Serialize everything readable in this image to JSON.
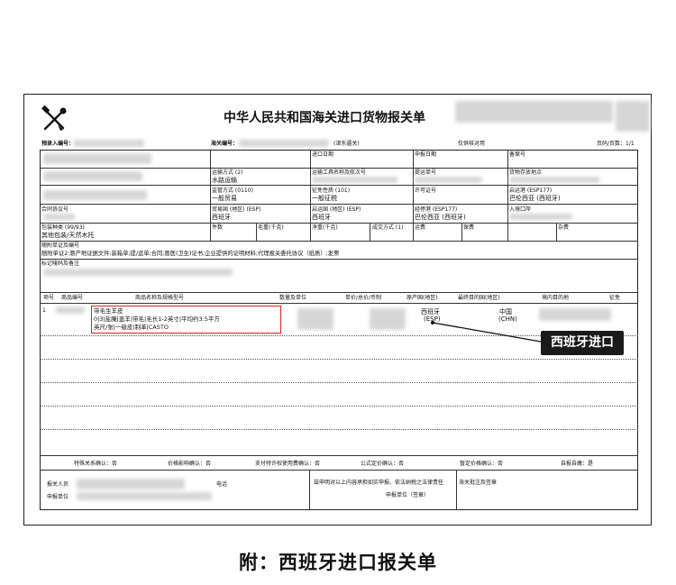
{
  "title": "中华人民共和国海关进口货物报关单",
  "header": {
    "preentry_label": "预录入编号：",
    "customs_no_label": "海关编号：",
    "customs_port": "(津东疆关)",
    "use_note": "仅供核对用",
    "page_label": "页码/页数：1/1"
  },
  "row1": {
    "import_date": "进口日期",
    "declare_date": "申报日期",
    "record_no": "备案号"
  },
  "row2": {
    "transport_label": "运输方式 (2)",
    "transport_value": "水路运输",
    "vessel_label": "运输工具名称及航次号",
    "bill_label": "提运单号",
    "storage_label": "货物存放地点"
  },
  "row3": {
    "supervision_label": "监管方式 (0110)",
    "supervision_value": "一般贸易",
    "tax_label": "征免性质 (101)",
    "tax_value": "一般征税",
    "license_label": "许可证号",
    "port_label": "启运港 (ESP177)",
    "port_value": "巴伦西亚 (西班牙)"
  },
  "row4": {
    "contract_label": "合同协议号",
    "trade_country_label": "贸易国 (地区) (ESP)",
    "trade_country_value": "西班牙",
    "origin_country_label": "启运国 (地区) (ESP)",
    "origin_country_value": "西班牙",
    "stop_port_label": "经停港 (ESP177)",
    "stop_port_value": "巴伦西亚 (西班牙)",
    "entry_port_label": "入境口岸"
  },
  "row5": {
    "package_label": "包装种类 (99/93)",
    "package_value": "其他包装/天然木托",
    "pieces_label": "件数",
    "gross_label": "毛重(千克)",
    "net_label": "净重(千克)",
    "deal_label": "成交方式 (1)",
    "freight_label": "运费",
    "insurance_label": "保费",
    "misc_label": "杂费"
  },
  "docs": {
    "label": "随附单证及编号",
    "value": "随附单证2:原产地证据文件;装箱单;提/运单;合同;兽医(卫生)证书;企业提供的证明材料;代理报关委托协议（纸质）;发票"
  },
  "marks_label": "标记唛码及备注",
  "goods_header": {
    "no": "项号",
    "code": "商品编号",
    "name": "商品名称及规格型号",
    "qty": "数量及单位",
    "price": "单价/总价/币制",
    "origin": "原产国(地区)",
    "dest_country": "最终目的国(地区)",
    "dest_place": "境内目的地",
    "levy": "征免"
  },
  "goods_item": {
    "no": "1",
    "line1": "带毛生羊皮",
    "line2": "0|3|盐腌|盖羊|带毛|毛长1-2英寸|平均约3.5平方",
    "line3": "英尺/张|一级皮|制革|CASTO",
    "origin": "西班牙",
    "origin_code": "(ESP)",
    "dest": "中国",
    "dest_code": "(CHN)"
  },
  "callout": "西班牙进口",
  "confirm": {
    "special": "特殊关系确认：否",
    "price_effect": "价格影响确认：否",
    "royalty": "支付特许权使用费确认：否",
    "formula": "公式定价确认：否",
    "provisional": "暂定价格确认：否",
    "self_pay": "自报自缴：是"
  },
  "footer": {
    "declarant": "报关人员",
    "unit": "申报单位",
    "phone": "电话",
    "statement": "兹申明对以上内容承担如实申报、依法纳税之法律责任",
    "seal": "申报单位（签章）",
    "customs_note": "海关批注及签章"
  },
  "caption": "附：西班牙进口报关单"
}
